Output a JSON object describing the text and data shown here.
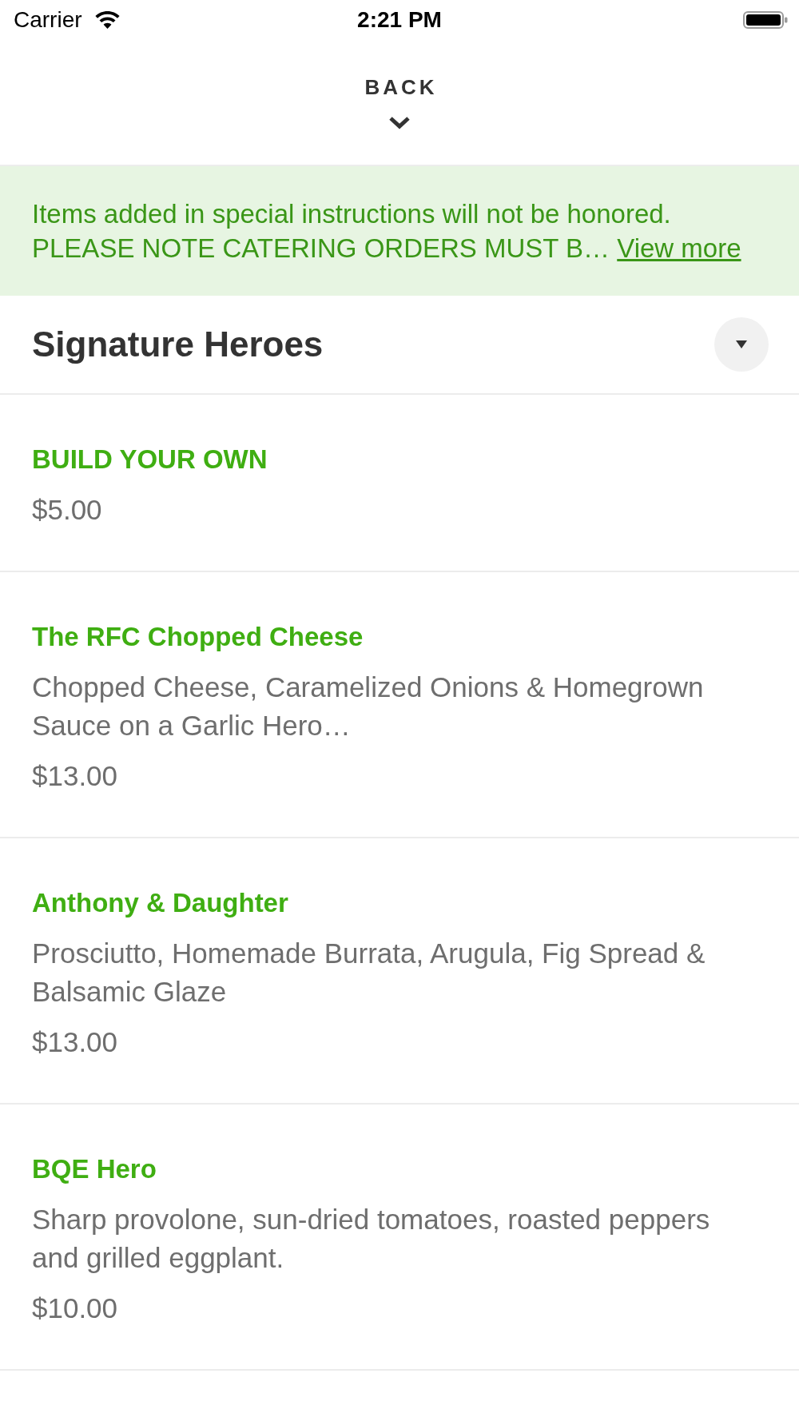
{
  "status_bar": {
    "carrier": "Carrier",
    "time": "2:21 PM"
  },
  "header": {
    "back_label": "BACK"
  },
  "notice": {
    "text": "Items added in special instructions will not be honored. PLEASE NOTE CATERING ORDERS MUST B…",
    "link": "View more"
  },
  "section": {
    "title": "Signature Heroes"
  },
  "items": [
    {
      "name": "BUILD YOUR OWN",
      "price": "$5.00"
    },
    {
      "name": "The RFC Chopped Cheese",
      "description": "Chopped Cheese, Caramelized Onions & Homegrown Sauce on a Garlic Hero…",
      "price": "$13.00"
    },
    {
      "name": "Anthony & Daughter",
      "description": "Prosciutto, Homemade Burrata, Arugula, Fig Spread & Balsamic Glaze",
      "price": "$13.00"
    },
    {
      "name": "BQE Hero",
      "description": "Sharp provolone, sun-dried tomatoes, roasted peppers and grilled eggplant.",
      "price": "$10.00"
    }
  ]
}
